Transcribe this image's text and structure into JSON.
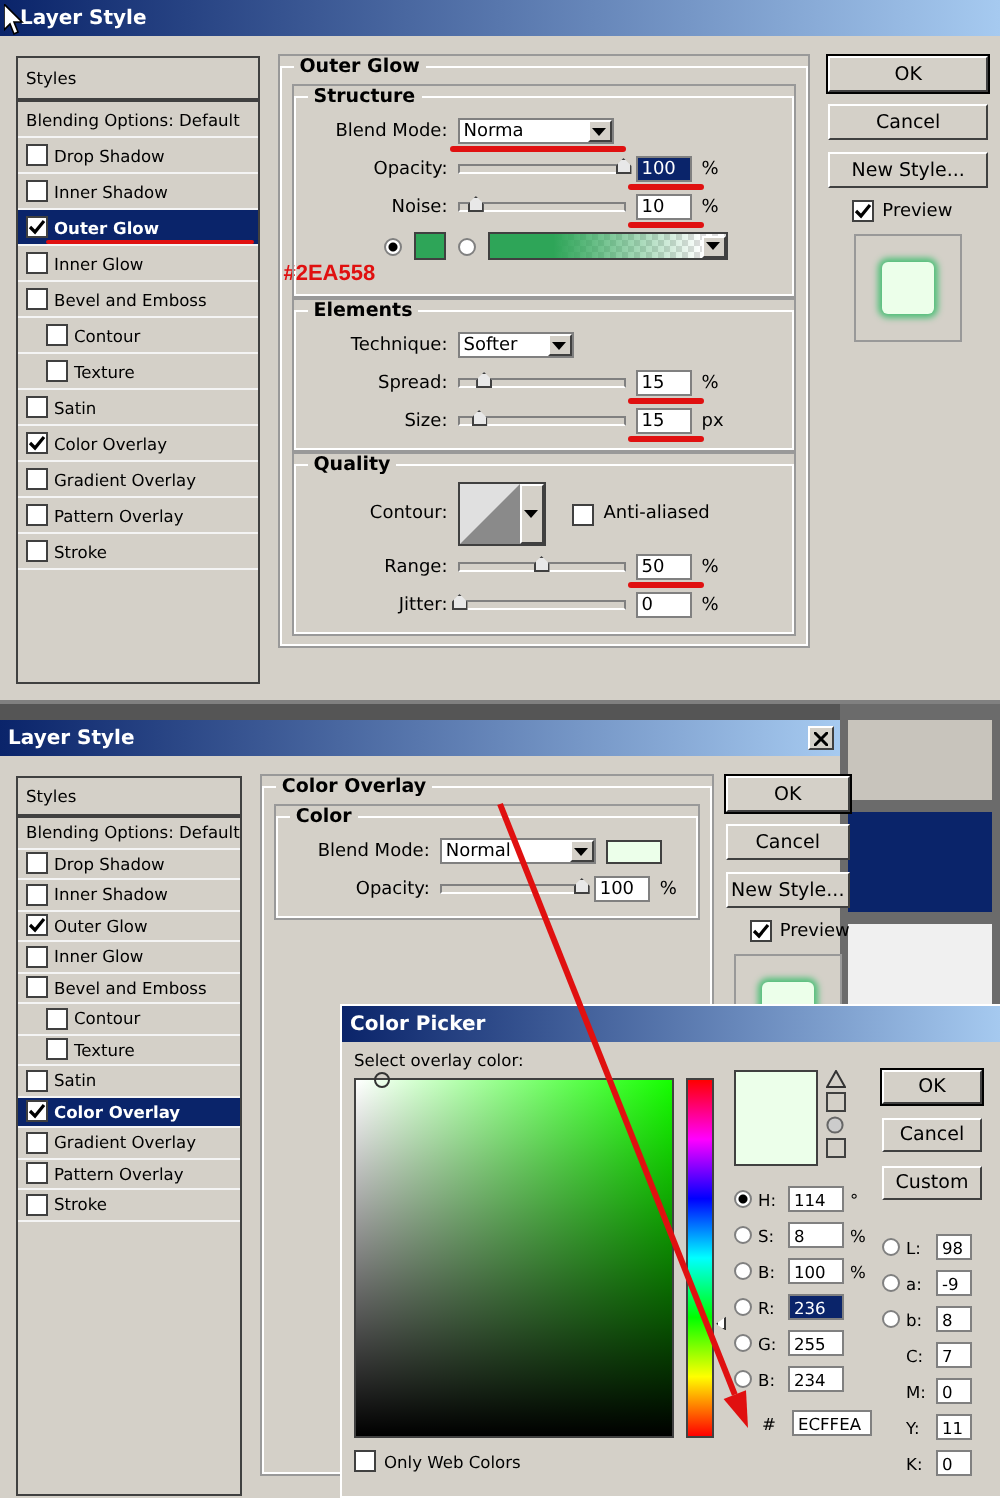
{
  "top_dialog": {
    "title": "Layer Style",
    "styles_header": "Styles",
    "styles": [
      {
        "label": "Blending Options: Default",
        "kind": "header",
        "selected": false
      },
      {
        "label": "Drop Shadow",
        "kind": "check",
        "checked": false,
        "selected": false
      },
      {
        "label": "Inner Shadow",
        "kind": "check",
        "checked": false,
        "selected": false
      },
      {
        "label": "Outer Glow",
        "kind": "check",
        "checked": true,
        "selected": true,
        "annotated": true
      },
      {
        "label": "Inner Glow",
        "kind": "check",
        "checked": false,
        "selected": false
      },
      {
        "label": "Bevel and Emboss",
        "kind": "check",
        "checked": false,
        "selected": false,
        "children": [
          {
            "label": "Contour",
            "kind": "check",
            "checked": false,
            "selected": false
          },
          {
            "label": "Texture",
            "kind": "check",
            "checked": false,
            "selected": false
          }
        ]
      },
      {
        "label": "Satin",
        "kind": "check",
        "checked": false,
        "selected": false
      },
      {
        "label": "Color Overlay",
        "kind": "check",
        "checked": true,
        "selected": false
      },
      {
        "label": "Gradient Overlay",
        "kind": "check",
        "checked": false,
        "selected": false
      },
      {
        "label": "Pattern Overlay",
        "kind": "check",
        "checked": false,
        "selected": false
      },
      {
        "label": "Stroke",
        "kind": "check",
        "checked": false,
        "selected": false
      }
    ],
    "panel": {
      "title": "Outer Glow",
      "structure": {
        "title": "Structure",
        "blend_mode": {
          "label": "Blend Mode:",
          "value": "Norma",
          "annotated": true
        },
        "sliders": [
          {
            "label": "Opacity:",
            "level": 1.0,
            "value": "100",
            "unit": "%",
            "highlighted": true,
            "annotated": true
          },
          {
            "label": "Noise:",
            "level": 0.1,
            "value": "10",
            "unit": "%",
            "highlighted": false,
            "annotated": true
          }
        ],
        "fill_options": [
          {
            "kind": "solid",
            "selected": true,
            "color": "#2ea558"
          },
          {
            "kind": "gradient",
            "selected": false,
            "color": "#2ea558"
          }
        ],
        "annotation": "#2EA558"
      },
      "elements": {
        "title": "Elements",
        "technique": {
          "label": "Technique:",
          "value": "Softer"
        },
        "sliders": [
          {
            "label": "Spread:",
            "level": 0.15,
            "value": "15",
            "unit": "%",
            "highlighted": false,
            "annotated": true
          },
          {
            "label": "Size:",
            "level": 0.12,
            "value": "15",
            "unit": "px",
            "highlighted": false,
            "annotated": true
          }
        ]
      },
      "quality": {
        "title": "Quality",
        "contour_label": "Contour:",
        "anti_aliased": {
          "label": "Anti-aliased",
          "checked": false
        },
        "sliders": [
          {
            "label": "Range:",
            "level": 0.5,
            "value": "50",
            "unit": "%",
            "highlighted": false,
            "annotated": true
          },
          {
            "label": "Jitter:",
            "level": 0,
            "value": "0",
            "unit": "%",
            "highlighted": false
          }
        ]
      }
    },
    "buttons": [
      "OK",
      "Cancel",
      "New Style..."
    ],
    "preview": {
      "label": "Preview",
      "checked": true
    }
  },
  "bottom_dialog": {
    "title": "Layer Style",
    "styles_header": "Styles",
    "styles": [
      {
        "label": "Blending Options: Default",
        "kind": "header",
        "selected": false
      },
      {
        "label": "Drop Shadow",
        "kind": "check",
        "checked": false,
        "selected": false
      },
      {
        "label": "Inner Shadow",
        "kind": "check",
        "checked": false,
        "selected": false
      },
      {
        "label": "Outer Glow",
        "kind": "check",
        "checked": true,
        "selected": false
      },
      {
        "label": "Inner Glow",
        "kind": "check",
        "checked": false,
        "selected": false
      },
      {
        "label": "Bevel and Emboss",
        "kind": "check",
        "checked": false,
        "selected": false,
        "children": [
          {
            "label": "Contour",
            "kind": "check",
            "checked": false,
            "selected": false
          },
          {
            "label": "Texture",
            "kind": "check",
            "checked": false,
            "selected": false
          }
        ]
      },
      {
        "label": "Satin",
        "kind": "check",
        "checked": false,
        "selected": false
      },
      {
        "label": "Color Overlay",
        "kind": "check",
        "checked": true,
        "selected": true
      },
      {
        "label": "Gradient Overlay",
        "kind": "check",
        "checked": false,
        "selected": false
      },
      {
        "label": "Pattern Overlay",
        "kind": "check",
        "checked": false,
        "selected": false
      },
      {
        "label": "Stroke",
        "kind": "check",
        "checked": false,
        "selected": false
      }
    ],
    "panel": {
      "title": "Color Overlay",
      "group_title": "Color",
      "blend_mode": {
        "label": "Blend Mode:",
        "value": "Normal"
      },
      "slider": {
        "label": "Opacity:",
        "level": 1.0,
        "value": "100",
        "unit": "%"
      }
    },
    "buttons": [
      "OK",
      "Cancel",
      "New Style..."
    ],
    "preview": {
      "label": "Preview",
      "checked": true
    }
  },
  "color_picker": {
    "title": "Color Picker",
    "prompt": "Select overlay color:",
    "hue_slider": {
      "level": 0.32
    },
    "buttons": [
      "OK",
      "Cancel",
      "Custom"
    ],
    "hsb": [
      {
        "label": "H:",
        "value": "114",
        "unit": "°",
        "selected": true
      },
      {
        "label": "S:",
        "value": "8",
        "unit": "%",
        "selected": false
      },
      {
        "label": "B:",
        "value": "100",
        "unit": "%",
        "selected": false
      }
    ],
    "rgb": [
      {
        "label": "R:",
        "value": "236",
        "selected": false,
        "highlighted": true
      },
      {
        "label": "G:",
        "value": "255",
        "selected": false,
        "highlighted": false
      },
      {
        "label": "B:",
        "value": "234",
        "selected": false,
        "highlighted": false
      }
    ],
    "lab": [
      {
        "label": "L:",
        "value": "98",
        "selected": false
      },
      {
        "label": "a:",
        "value": "-9",
        "selected": false
      },
      {
        "label": "b:",
        "value": "8",
        "selected": false
      }
    ],
    "cmyk": [
      {
        "label": "C:",
        "value": "7"
      },
      {
        "label": "M:",
        "value": "0"
      },
      {
        "label": "Y:",
        "value": "11"
      },
      {
        "label": "K:",
        "value": "0"
      }
    ],
    "hex": {
      "label": "#",
      "value": "ECFFEA"
    },
    "web_only": {
      "label": "Only Web Colors",
      "checked": false
    }
  }
}
